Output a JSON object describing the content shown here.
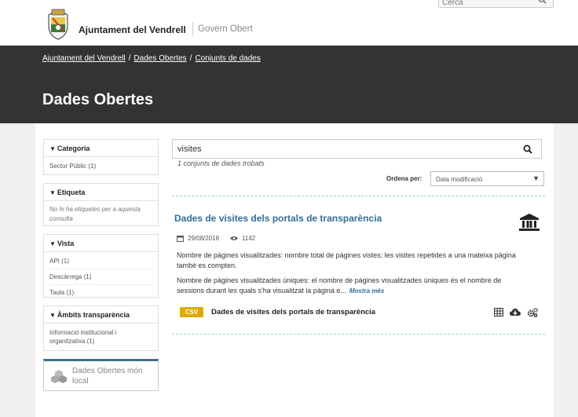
{
  "header": {
    "brand": "Ajuntament del Vendrell",
    "subbrand": "Govern Obert",
    "search_placeholder": "Cerca"
  },
  "breadcrumb": [
    "Ajuntament del Vendrell",
    "Dades Obertes",
    "Conjunts de dades"
  ],
  "page_title": "Dades Obertes",
  "facets": {
    "categoria": {
      "title": "Categoria",
      "items": [
        "Sector Públic (1)"
      ]
    },
    "etiqueta": {
      "title": "Etiqueta",
      "empty": "No hi ha etiquetes per a aquesta consulta"
    },
    "vista": {
      "title": "Vista",
      "items": [
        "API (1)",
        "Descàrrega (1)",
        "Taula (1)"
      ]
    },
    "ambits": {
      "title": "Àmbits transparència",
      "items": [
        "Informació institucional i organitzativa (1)"
      ]
    }
  },
  "local_box": {
    "line1": "Dades Obertes món",
    "line2": "local"
  },
  "search": {
    "value": "visites"
  },
  "results_count": "1 conjunts de dades trobats",
  "sort": {
    "label": "Ordena per:",
    "value": "Data modificació"
  },
  "result": {
    "title": "Dades de visites dels portals de transparència",
    "date": "29/08/2018",
    "views": "1142",
    "desc1": "Nombre de pàgines visualitzades: nombre total de pàgines vistes; les visites repetides a una mateixa pàgina també es compten.",
    "desc2": "Nombre de pàgines visualitzades úniques: el nombre de pàgines visualitzades úniques és el nombre de sessions durant les quals s'ha visualitzat la pàgina e...",
    "more": "Mostra més",
    "resource": {
      "format": "CSV",
      "title": "Dades de visites dels portals de transparència"
    }
  },
  "colors": {
    "hero": "#333333",
    "link": "#336e97",
    "csv": "#dcab00",
    "accent": "#40708f"
  }
}
